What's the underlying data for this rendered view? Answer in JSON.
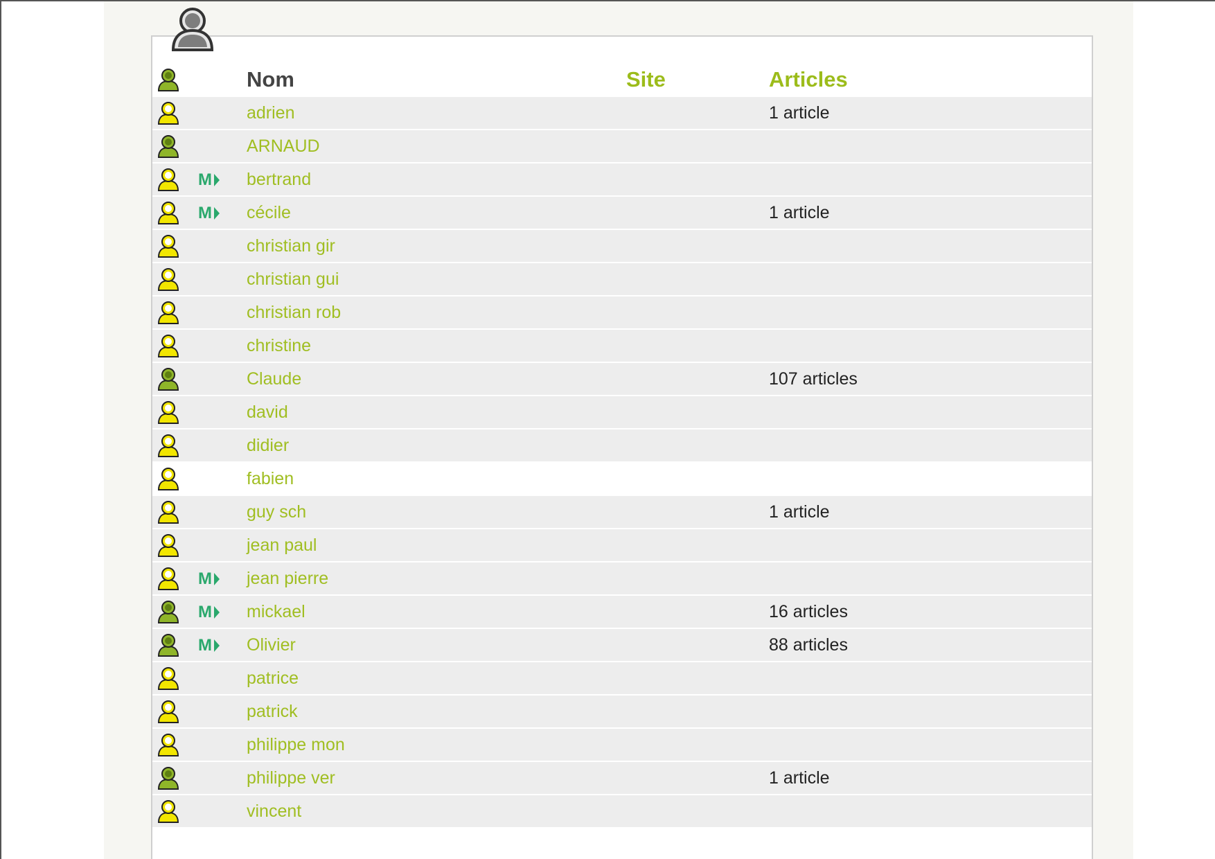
{
  "colors": {
    "link": "#a0be22",
    "header_accent": "#9cbc1b",
    "header_dark": "#444444",
    "row_bg": "#ededed",
    "row_highlight_bg": "#ffffff",
    "mail_icon": "#2aa86c",
    "icon_admin": "#8fb529",
    "icon_redactor": "#f2e600"
  },
  "panel": {
    "icon": "user-silhouette-icon"
  },
  "table": {
    "headers": {
      "name": "Nom",
      "site": "Site",
      "articles": "Articles"
    },
    "rows": [
      {
        "status": "redactor",
        "mail": false,
        "name": "adrien",
        "site": "",
        "articles": "1 article"
      },
      {
        "status": "admin",
        "mail": false,
        "name": "ARNAUD",
        "site": "",
        "articles": ""
      },
      {
        "status": "redactor",
        "mail": true,
        "name": "bertrand",
        "site": "",
        "articles": ""
      },
      {
        "status": "redactor",
        "mail": true,
        "name": "cécile",
        "site": "",
        "articles": "1 article"
      },
      {
        "status": "redactor",
        "mail": false,
        "name": "christian gir",
        "site": "",
        "articles": ""
      },
      {
        "status": "redactor",
        "mail": false,
        "name": "christian gui",
        "site": "",
        "articles": ""
      },
      {
        "status": "redactor",
        "mail": false,
        "name": "christian rob",
        "site": "",
        "articles": ""
      },
      {
        "status": "redactor",
        "mail": false,
        "name": "christine",
        "site": "",
        "articles": ""
      },
      {
        "status": "admin",
        "mail": false,
        "name": "Claude",
        "site": "",
        "articles": "107 articles"
      },
      {
        "status": "redactor",
        "mail": false,
        "name": "david",
        "site": "",
        "articles": ""
      },
      {
        "status": "redactor",
        "mail": false,
        "name": "didier",
        "site": "",
        "articles": ""
      },
      {
        "status": "redactor",
        "mail": false,
        "name": "fabien",
        "site": "",
        "articles": "",
        "highlight": true
      },
      {
        "status": "redactor",
        "mail": false,
        "name": "guy sch",
        "site": "",
        "articles": "1 article"
      },
      {
        "status": "redactor",
        "mail": false,
        "name": "jean paul",
        "site": "",
        "articles": ""
      },
      {
        "status": "redactor",
        "mail": true,
        "name": "jean pierre",
        "site": "",
        "articles": ""
      },
      {
        "status": "admin",
        "mail": true,
        "name": "mickael",
        "site": "",
        "articles": "16 articles"
      },
      {
        "status": "admin",
        "mail": true,
        "name": "Olivier",
        "site": "",
        "articles": "88 articles"
      },
      {
        "status": "redactor",
        "mail": false,
        "name": "patrice",
        "site": "",
        "articles": ""
      },
      {
        "status": "redactor",
        "mail": false,
        "name": "patrick",
        "site": "",
        "articles": ""
      },
      {
        "status": "redactor",
        "mail": false,
        "name": "philippe mon",
        "site": "",
        "articles": ""
      },
      {
        "status": "admin",
        "mail": false,
        "name": "philippe ver",
        "site": "",
        "articles": "1 article"
      },
      {
        "status": "redactor",
        "mail": false,
        "name": "vincent",
        "site": "",
        "articles": ""
      }
    ]
  }
}
